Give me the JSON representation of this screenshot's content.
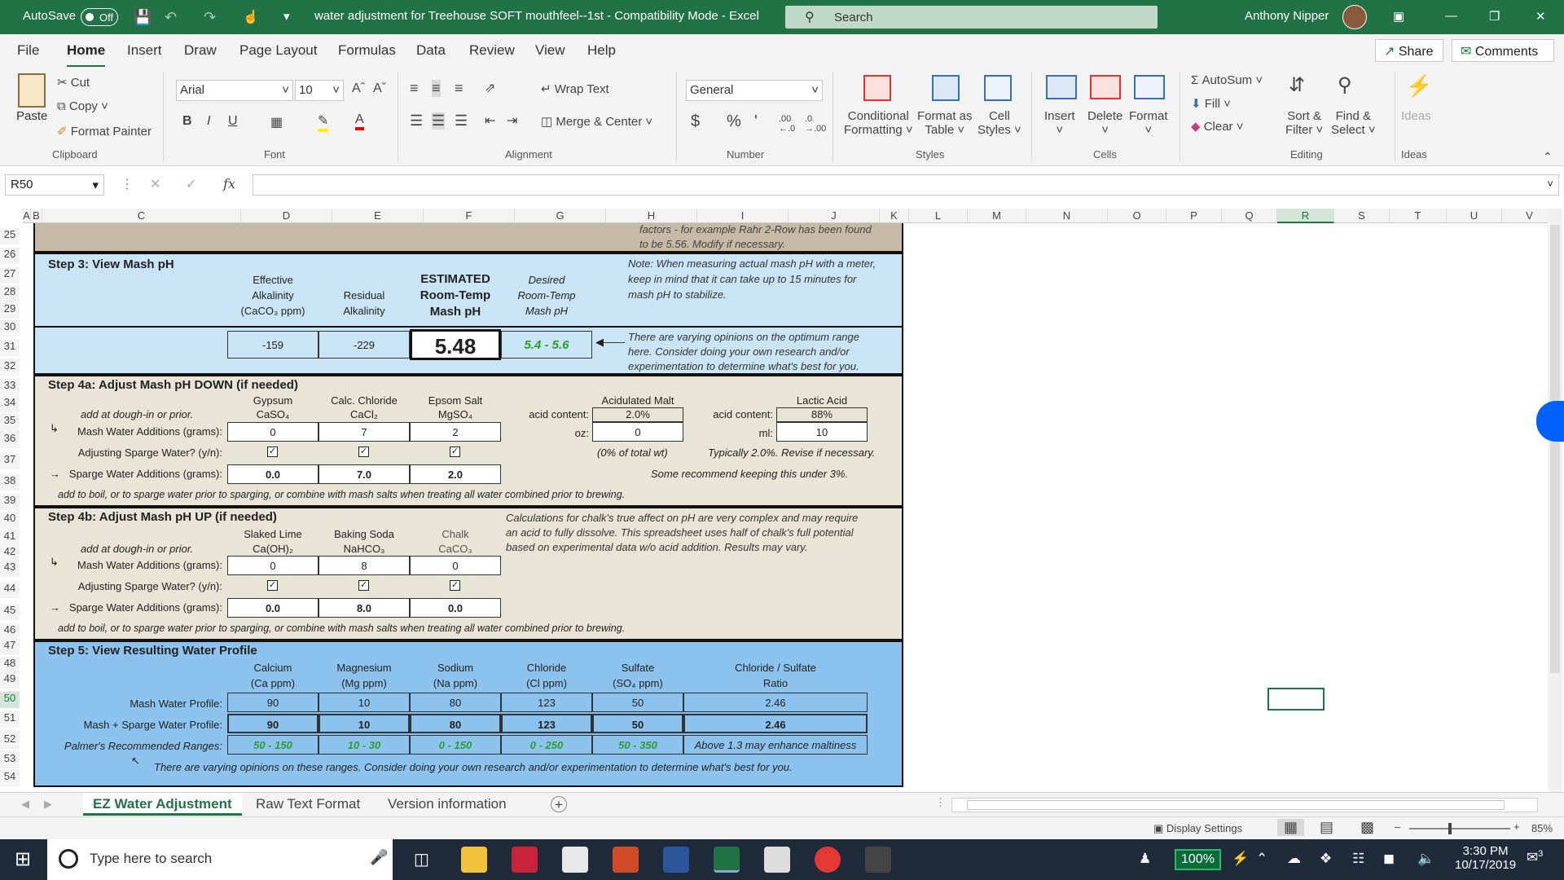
{
  "titlebar": {
    "autosave": "AutoSave",
    "autosave_state": "Off",
    "doc_title": "water adjustment for Treehouse SOFT mouthfeel--1st  -  Compatibility Mode  -  Excel",
    "search": "Search",
    "user": "Anthony Nipper"
  },
  "menu": {
    "tabs": [
      "File",
      "Home",
      "Insert",
      "Draw",
      "Page Layout",
      "Formulas",
      "Data",
      "Review",
      "View",
      "Help"
    ],
    "share": "Share",
    "comments": "Comments"
  },
  "ribbon": {
    "clipboard": {
      "paste": "Paste",
      "cut": "Cut",
      "copy": "Copy",
      "format_painter": "Format Painter",
      "group": "Clipboard"
    },
    "font": {
      "name": "Arial",
      "size": "10",
      "group": "Font"
    },
    "alignment": {
      "wrap": "Wrap Text",
      "merge": "Merge & Center",
      "group": "Alignment"
    },
    "number": {
      "format": "General",
      "group": "Number"
    },
    "styles": {
      "conditional": "Conditional",
      "conditional2": "Formatting",
      "format_as": "Format as",
      "format_as2": "Table",
      "cell": "Cell",
      "cell2": "Styles",
      "group": "Styles"
    },
    "cells": {
      "insert": "Insert",
      "delete": "Delete",
      "format": "Format",
      "group": "Cells"
    },
    "editing": {
      "autosum": "AutoSum",
      "fill": "Fill",
      "clear": "Clear",
      "sort": "Sort &",
      "sort2": "Filter",
      "find": "Find &",
      "find2": "Select",
      "group": "Editing"
    },
    "ideas": {
      "label": "Ideas",
      "group": "Ideas"
    }
  },
  "formula": {
    "namebox": "R50",
    "fx": "fx",
    "value": ""
  },
  "columns": [
    "A",
    "B",
    "C",
    "D",
    "E",
    "F",
    "G",
    "H",
    "I",
    "J",
    "K",
    "L",
    "M",
    "N",
    "O",
    "P",
    "Q",
    "R",
    "S",
    "T",
    "U",
    "V"
  ],
  "rows": [
    "25",
    "26",
    "27",
    "28",
    "29",
    "30",
    "31",
    "32",
    "33",
    "34",
    "35",
    "36",
    "37",
    "38",
    "39",
    "40",
    "41",
    "42",
    "43",
    "44",
    "45",
    "46",
    "47",
    "48",
    "49",
    "50",
    "51",
    "52",
    "53",
    "54"
  ],
  "sheet": {
    "top_note1": "factors - for example Rahr 2-Row has been found",
    "top_note2": "to be 5.56. Modify if necessary.",
    "step3": {
      "title": "Step 3: View Mash pH",
      "eff1": "Effective",
      "eff2": "Alkalinity",
      "eff3": "(CaCO₃ ppm)",
      "res1": "Residual",
      "res2": "Alkalinity",
      "est1": "ESTIMATED",
      "est2": "Room-Temp",
      "est3": "Mash pH",
      "des1": "Desired",
      "des2": "Room-Temp",
      "des3": "Mash pH",
      "eff_val": "-159",
      "res_val": "-229",
      "ph": "5.48",
      "desired": "5.4 - 5.6",
      "note1": "Note: When measuring actual mash pH with a meter,",
      "note2": "keep in mind that it can take up to 15 minutes for",
      "note3": "mash pH to stabilize.",
      "note4": "There are varying opinions on the optimum range",
      "note5": "here. Consider doing your own research and/or",
      "note6": "experimentation to determine what's best for you."
    },
    "step4a": {
      "title": "Step 4a: Adjust Mash pH DOWN (if needed)",
      "h1": "Gypsum",
      "h1b": "CaSO₄",
      "h2": "Calc. Chloride",
      "h2b": "CaCl₂",
      "h3": "Epsom Salt",
      "h3b": "MgSO₄",
      "dough": "add at dough-in or prior.",
      "mash_lbl": "Mash Water Additions (grams):",
      "m1": "0",
      "m2": "7",
      "m3": "2",
      "sparge_q": "Adjusting Sparge Water? (y/n):",
      "sparge_lbl": "Sparge Water Additions (grams):",
      "s1": "0.0",
      "s2": "7.0",
      "s3": "2.0",
      "boil": "add to boil, or to sparge water prior to sparging, or combine with mash salts when treating all water combined prior to brewing.",
      "acid_malt": "Acidulated Malt",
      "acid_content": "acid content:",
      "acid_val": "2.0%",
      "oz": "oz:",
      "oz_val": "0",
      "pct_total": "(0% of total wt)",
      "lactic": "Lactic Acid",
      "lac_content": "acid content:",
      "lac_val": "88%",
      "ml": "ml:",
      "ml_val": "10",
      "typ": "Typically 2.0%. Revise if necessary.",
      "some": "Some recommend keeping this under 3%."
    },
    "step4b": {
      "title": "Step 4b: Adjust Mash pH UP (if needed)",
      "h1": "Slaked Lime",
      "h1b": "Ca(OH)₂",
      "h2": "Baking Soda",
      "h2b": "NaHCO₃",
      "h3": "Chalk",
      "h3b": "CaCO₃",
      "dough": "add at dough-in or prior.",
      "mash_lbl": "Mash Water Additions (grams):",
      "m1": "0",
      "m2": "8",
      "m3": "0",
      "sparge_q": "Adjusting Sparge Water? (y/n):",
      "sparge_lbl": "Sparge Water Additions (grams):",
      "s1": "0.0",
      "s2": "8.0",
      "s3": "0.0",
      "boil": "add to boil, or to sparge water prior to sparging, or combine with mash salts when treating all water combined prior to brewing.",
      "calc1": "Calculations for chalk's true affect on pH are very complex and may require",
      "calc2": "an acid to fully dissolve.  This spreadsheet uses half of chalk's full potential",
      "calc3": "based on experimental data w/o acid addition.  Results may vary."
    },
    "step5": {
      "title": "Step 5: View Resulting Water Profile",
      "cols": [
        {
          "a": "Calcium",
          "b": "(Ca ppm)"
        },
        {
          "a": "Magnesium",
          "b": "(Mg ppm)"
        },
        {
          "a": "Sodium",
          "b": "(Na ppm)"
        },
        {
          "a": "Chloride",
          "b": "(Cl ppm)"
        },
        {
          "a": "Sulfate",
          "b": "(SO₄ ppm)"
        },
        {
          "a": "Chloride / Sulfate",
          "b": "Ratio"
        }
      ],
      "mash_lbl": "Mash Water Profile:",
      "mash": [
        "90",
        "10",
        "80",
        "123",
        "50",
        "2.46"
      ],
      "ms_lbl": "Mash + Sparge Water Profile:",
      "ms": [
        "90",
        "10",
        "80",
        "123",
        "50",
        "2.46"
      ],
      "pal_lbl": "Palmer's Recommended Ranges:",
      "pal": [
        "50 - 150",
        "10 - 30",
        "0 - 150",
        "0 - 250",
        "50 - 350",
        "Above 1.3 may enhance maltiness"
      ],
      "note": "There are varying opinions on these ranges. Consider doing your own research and/or experimentation to determine what's best for you."
    }
  },
  "tabs": [
    "EZ Water Adjustment",
    "Raw Text Format",
    "Version information"
  ],
  "status": {
    "display": "Display Settings",
    "zoom": "85%"
  },
  "taskbar": {
    "search": "Type here to search",
    "battery": "100%",
    "time": "3:30 PM",
    "date": "10/17/2019",
    "notif": "3"
  }
}
